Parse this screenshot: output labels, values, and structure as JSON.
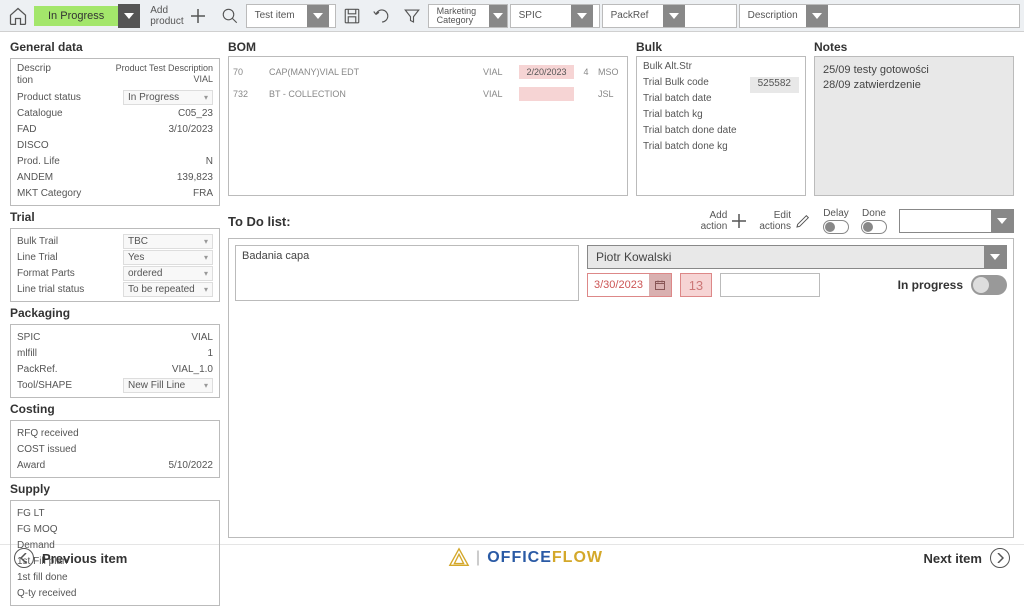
{
  "toolbar": {
    "status": "In Progress",
    "add_product": "Add\nproduct",
    "test_item": "Test item",
    "marketing_cat": "Marketing\nCategory",
    "spic": "SPIC",
    "packref": "PackRef",
    "description": "Description"
  },
  "general": {
    "title": "General data",
    "rows": [
      {
        "k": "Descrip\ntion",
        "v": "Product Test Description\nVIAL"
      },
      {
        "k": "Product status",
        "dd": "In Progress"
      },
      {
        "k": "Catalogue",
        "v": "C05_23"
      },
      {
        "k": "FAD",
        "v": "3/10/2023"
      },
      {
        "k": "DISCO",
        "v": ""
      },
      {
        "k": "Prod. Life",
        "v": "N"
      },
      {
        "k": "ANDEM",
        "v": "139,823"
      },
      {
        "k": "MKT Category",
        "v": "FRA"
      }
    ]
  },
  "trial": {
    "title": "Trial",
    "rows": [
      {
        "k": "Bulk Trail",
        "dd": "TBC"
      },
      {
        "k": "Line Trial",
        "dd": "Yes"
      },
      {
        "k": "Format Parts",
        "dd": "ordered"
      },
      {
        "k": "Line trial status",
        "dd": "To be repeated"
      }
    ]
  },
  "packaging": {
    "title": "Packaging",
    "rows": [
      {
        "k": "SPIC",
        "v": "VIAL"
      },
      {
        "k": "mlfill",
        "v": "1"
      },
      {
        "k": "PackRef.",
        "v": "VIAL_1.0"
      },
      {
        "k": "Tool/SHAPE",
        "dd": "New Fill Line"
      }
    ]
  },
  "costing": {
    "title": "Costing",
    "rows": [
      {
        "k": "RFQ received",
        "v": ""
      },
      {
        "k": "COST issued",
        "v": ""
      },
      {
        "k": "Award",
        "v": "5/10/2022"
      }
    ]
  },
  "supply": {
    "title": "Supply",
    "rows": [
      {
        "k": "FG LT",
        "v": ""
      },
      {
        "k": "FG MOQ",
        "v": ""
      },
      {
        "k": "Demand",
        "v": ""
      },
      {
        "k": "1st Fill plan",
        "v": ""
      },
      {
        "k": "1st fill done",
        "v": ""
      },
      {
        "k": "Q-ty received",
        "v": ""
      }
    ]
  },
  "bom": {
    "title": "BOM",
    "rows": [
      {
        "c1": "70",
        "c2": "CAP(MANY)VIAL EDT",
        "c3": "VIAL",
        "c4": "2/20/2023",
        "c5": "4",
        "c6": "MSO"
      },
      {
        "c1": "732",
        "c2": "BT - COLLECTION",
        "c3": "VIAL",
        "c4": "",
        "c5": "",
        "c6": "JSL"
      }
    ]
  },
  "bulk": {
    "title": "Bulk",
    "rows": [
      {
        "k": "Bulk Alt.Str",
        "v": ""
      },
      {
        "k": "Trial Bulk code",
        "badge": "525582"
      },
      {
        "k": "Trial batch date",
        "v": ""
      },
      {
        "k": "Trial batch kg",
        "v": ""
      },
      {
        "k": "Trial batch done date",
        "v": ""
      },
      {
        "k": "Trial batch done kg",
        "v": ""
      }
    ]
  },
  "notes": {
    "title": "Notes",
    "text": "25/09 testy gotowości\n28/09 zatwierdzenie"
  },
  "todo": {
    "title": "To Do list:",
    "add_action": "Add\naction",
    "edit_actions": "Edit\nactions",
    "delay": "Delay",
    "done": "Done",
    "item_desc": "Badania capa",
    "person": "Piotr Kowalski",
    "date": "3/30/2023",
    "num": "13",
    "status": "In progress"
  },
  "footer": {
    "prev": "Previous item",
    "next": "Next item",
    "logo1": "OFFICE",
    "logo2": "FLOW"
  }
}
